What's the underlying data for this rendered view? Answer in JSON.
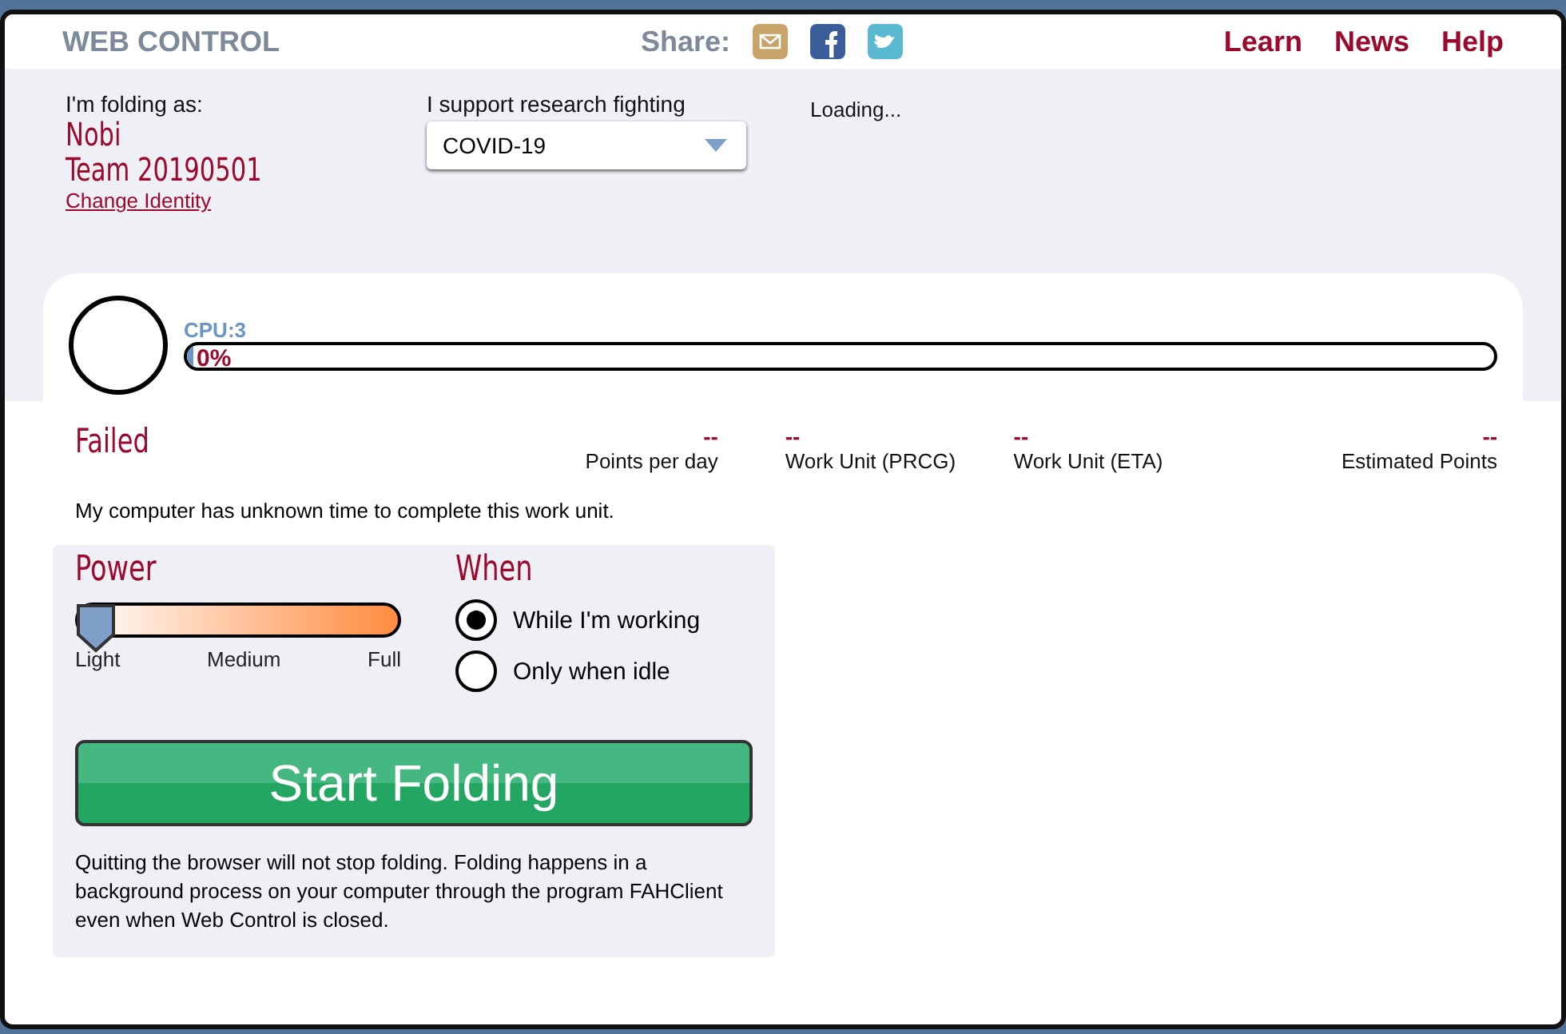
{
  "header": {
    "title": "WEB CONTROL",
    "share_label": "Share:",
    "share_icons": [
      {
        "kind": "email"
      },
      {
        "kind": "facebook"
      },
      {
        "kind": "twitter"
      }
    ],
    "nav": [
      "Learn",
      "News",
      "Help"
    ]
  },
  "identity": {
    "label": "I'm folding as:",
    "name": "Nobi",
    "team": "Team 20190501",
    "change_link": "Change Identity"
  },
  "cause": {
    "label": "I support research fighting",
    "value": "COVID-19"
  },
  "loading": "Loading...",
  "slot": {
    "cpu_label": "CPU:3",
    "progress_text": "0%",
    "level": 0,
    "status": "Failed",
    "stats": [
      {
        "value": "--",
        "label": "Points per day"
      },
      {
        "value": "--",
        "label": "Work Unit (PRCG)"
      },
      {
        "value": "--",
        "label": "Work Unit (ETA)"
      },
      {
        "value": "--",
        "label": "Estimated Points"
      }
    ],
    "message": "My computer has unknown time to complete this work unit."
  },
  "power": {
    "title": "Power",
    "level": 0,
    "ticks": [
      "Light",
      "Medium",
      "Full"
    ]
  },
  "when": {
    "title": "When",
    "options": [
      {
        "label": "While I'm working",
        "selected": true
      },
      {
        "label": "Only when idle",
        "selected": false
      }
    ]
  },
  "start_button": "Start Folding",
  "note": "Quitting the browser will not stop folding. Folding happens in a background process on your computer through the program FAHClient even when Web Control is closed."
}
